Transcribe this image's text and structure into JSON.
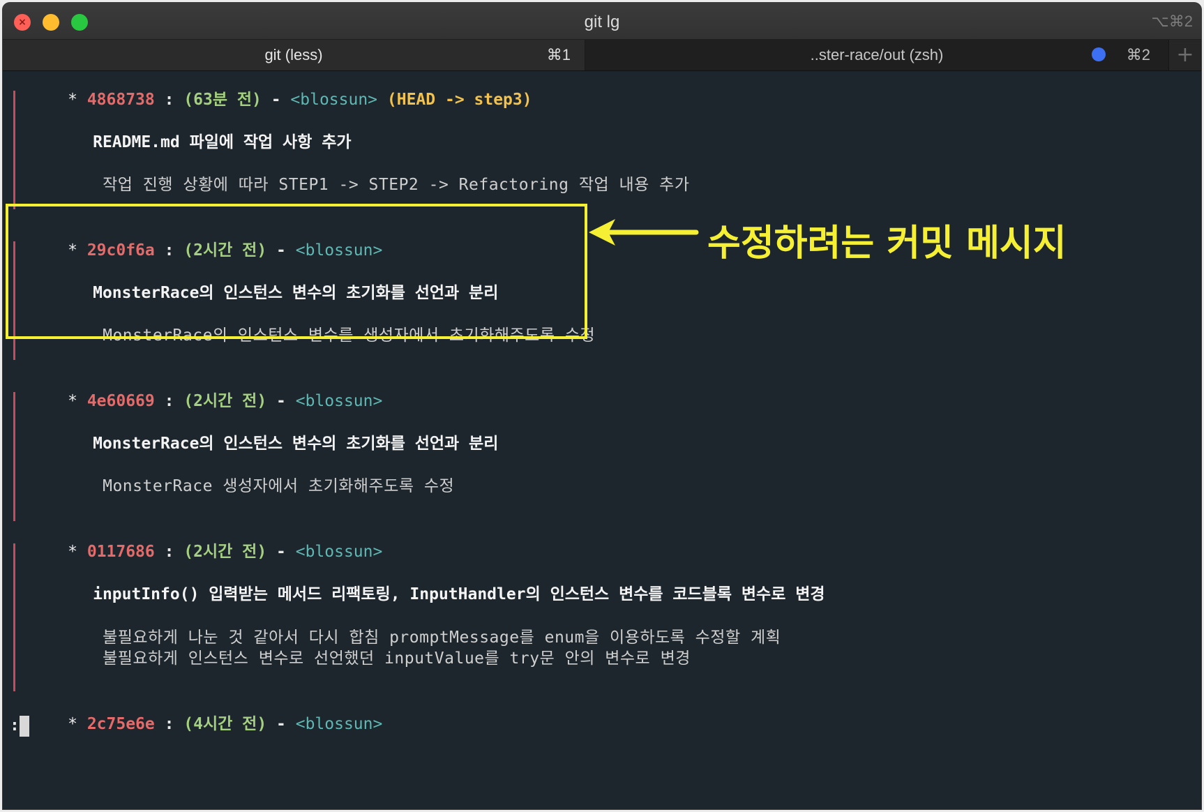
{
  "window": {
    "title": "git lg",
    "shortcut": "⌥⌘2"
  },
  "tabs": [
    {
      "label": "git (less)",
      "shortcut": "⌘1"
    },
    {
      "label": "..ster-race/out (zsh)",
      "shortcut": "⌘2"
    }
  ],
  "new_tab_symbol": "+",
  "colors": {
    "hash": "#e56a6a",
    "time": "#a4d07f",
    "author": "#5fb8b4",
    "refs": "#f2c24c",
    "graph": "#c94a5a",
    "annotation": "#f6f035",
    "activity_dot": "#3d6ff2"
  },
  "commits": [
    {
      "star": "*",
      "hash": "4868738",
      "sep": " : ",
      "time": "(63분 전)",
      "dash": " - ",
      "author": "<blossun>",
      "refs": "(HEAD -> step3)",
      "subject": "README.md 파일에 작업 사항 추가",
      "body": [
        "작업 진행 상황에 따라 STEP1 -> STEP2 -> Refactoring 작업 내용 추가"
      ]
    },
    {
      "star": "*",
      "hash": "29c0f6a",
      "sep": " : ",
      "time": "(2시간 전)",
      "dash": " - ",
      "author": "<blossun>",
      "refs": "",
      "subject": "MonsterRace의 인스턴스 변수의 초기화를 선언과 분리",
      "body": [
        "MonsterRace의 인스턴스 변수를 생성자에서 초기화해주도록 수정"
      ]
    },
    {
      "star": "*",
      "hash": "4e60669",
      "sep": " : ",
      "time": "(2시간 전)",
      "dash": " - ",
      "author": "<blossun>",
      "refs": "",
      "subject": "MonsterRace의 인스턴스 변수의 초기화를 선언과 분리",
      "body": [
        "MonsterRace 생성자에서 초기화해주도록 수정"
      ]
    },
    {
      "star": "*",
      "hash": "0117686",
      "sep": " : ",
      "time": "(2시간 전)",
      "dash": " - ",
      "author": "<blossun>",
      "refs": "",
      "subject": "inputInfo() 입력받는 메서드 리팩토링, InputHandler의 인스턴스 변수를 코드블록 변수로 변경",
      "body": [
        "불필요하게 나눈 것 같아서 다시 합침 promptMessage를 enum을 이용하도록 수정할 계획",
        "불필요하게 인스턴스 변수로 선언했던 inputValue를 try문 안의 변수로 변경"
      ]
    },
    {
      "star": "*",
      "hash": "2c75e6e",
      "sep": " : ",
      "time": "(4시간 전)",
      "dash": " - ",
      "author": "<blossun>",
      "refs": "",
      "subject": "",
      "body": []
    }
  ],
  "prompt": ":",
  "annotation": {
    "text": "수정하려는 커밋 메시지"
  }
}
